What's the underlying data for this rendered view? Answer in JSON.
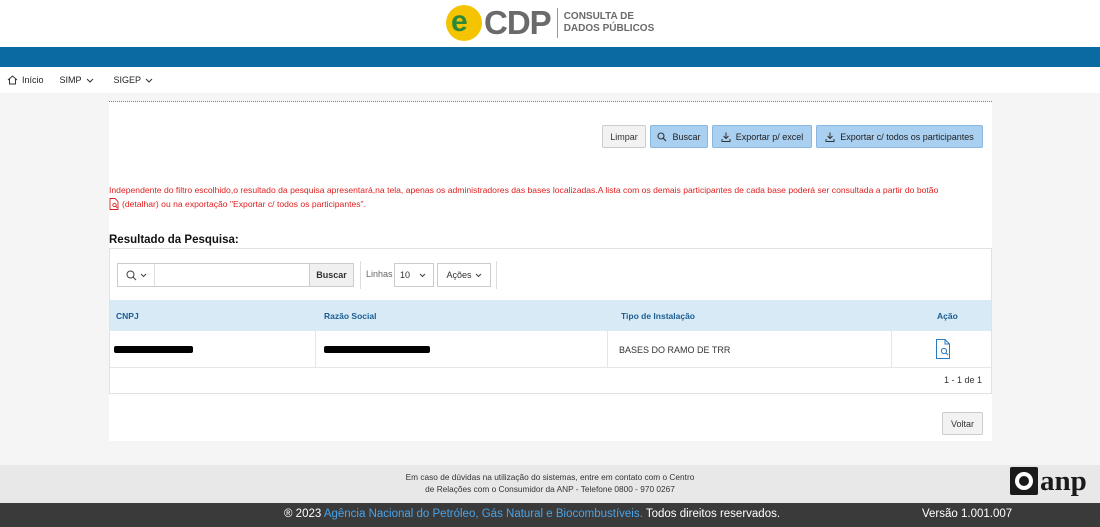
{
  "header": {
    "logo_letter": "e",
    "logo_text": "CDP",
    "logo_sub_line1": "CONSULTA DE",
    "logo_sub_line2": "DADOS PÚBLICOS"
  },
  "nav": {
    "home": "Início",
    "simp": "SIMP",
    "sigep": "SIGEP"
  },
  "actions": {
    "limpar": "Limpar",
    "buscar": "Buscar",
    "export_excel": "Exportar p/ excel",
    "export_all": "Exportar c/ todos os participantes"
  },
  "warning": {
    "line1": "Independente do filtro escolhido,o resultado da pesquisa apresentará,na tela, apenas os administradores das bases localizadas.A lista com os demais participantes de cada base poderá ser consultada a partir do botão",
    "line2": "(detalhar) ou na exportação \"Exportar c/ todos os participantes\"."
  },
  "results": {
    "title": "Resultado da Pesquisa:",
    "toolbar": {
      "search_placeholder": "",
      "search_button": "Buscar",
      "rows_label": "Linhas",
      "rows_value": "10",
      "actions_label": "Ações"
    },
    "columns": [
      "CNPJ",
      "Razão Social",
      "Tipo de Instalação",
      "Ação"
    ],
    "rows": [
      {
        "cnpj": "",
        "razao_social": "",
        "tipo": "BASES DO RAMO DE TRR"
      }
    ],
    "pagination": "1 - 1 de 1"
  },
  "voltar": "Voltar",
  "footer": {
    "line1": "Em caso de dúvidas na utilização do sistemas, entre em contato com o Centro",
    "line2": "de Relações com o Consumidor da ANP - Telefone 0800 - 970 0267",
    "anp_logo": "anp"
  },
  "bottom": {
    "copyright_prefix": "® 2023",
    "agency_link": "Agência Nacional do Petróleo, Gás Natural e Biocombustíveis.",
    "rights": "Todos direitos reservados.",
    "version": "Versão 1.001.007"
  },
  "colors": {
    "brand_blue": "#0a6aa1",
    "button_blue": "#a9cff1",
    "warning_red": "#e02020",
    "table_header_bg": "#d9eaf7"
  },
  "icons": [
    "home-icon",
    "search-icon",
    "download-icon",
    "document-search-icon",
    "chevron-down-icon"
  ]
}
